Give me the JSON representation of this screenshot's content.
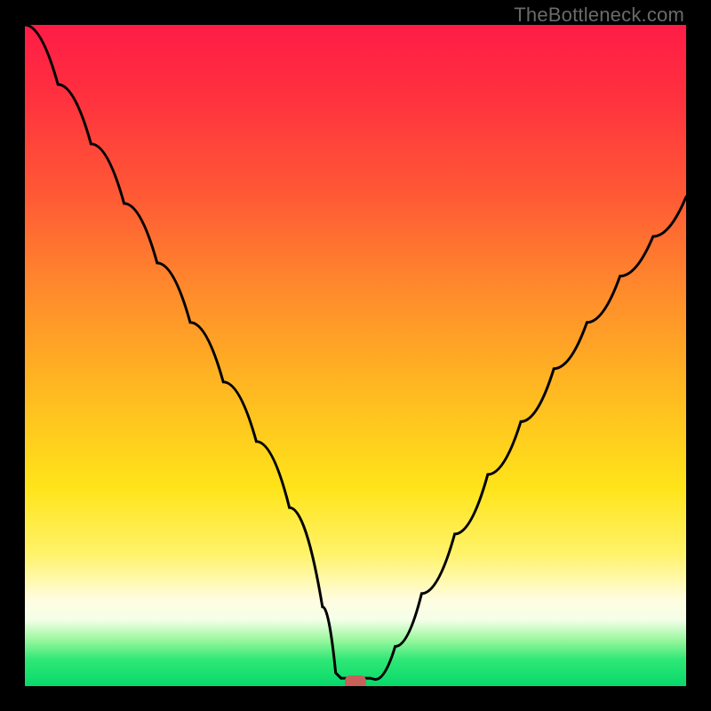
{
  "attribution": "TheBottleneck.com",
  "chart_data": {
    "type": "line",
    "title": "",
    "xlabel": "",
    "ylabel": "",
    "xlim": [
      0,
      100
    ],
    "ylim": [
      0,
      100
    ],
    "grid": false,
    "legend": false,
    "background": "red-yellow-green vertical gradient",
    "series": [
      {
        "name": "bottleneck-curve",
        "color": "#000000",
        "x": [
          0,
          5,
          10,
          15,
          20,
          25,
          30,
          35,
          40,
          45,
          47,
          50,
          53,
          56,
          60,
          65,
          70,
          75,
          80,
          85,
          90,
          95,
          100
        ],
        "y": [
          100,
          91,
          82,
          73,
          64,
          55,
          46,
          37,
          27,
          12,
          2,
          0,
          1,
          6,
          14,
          23,
          32,
          40,
          48,
          55,
          62,
          68,
          74
        ]
      }
    ],
    "marker": {
      "name": "current-config",
      "x": 50,
      "y": 0,
      "color": "#c6605a",
      "shape": "rounded-rect"
    }
  },
  "colors": {
    "frame": "#000000",
    "curve": "#000000",
    "marker": "#c6605a",
    "gradient_top": "#ff1c47",
    "gradient_mid": "#ffe41a",
    "gradient_bottom": "#06d96b",
    "attribution_text": "#6a6a6a"
  }
}
